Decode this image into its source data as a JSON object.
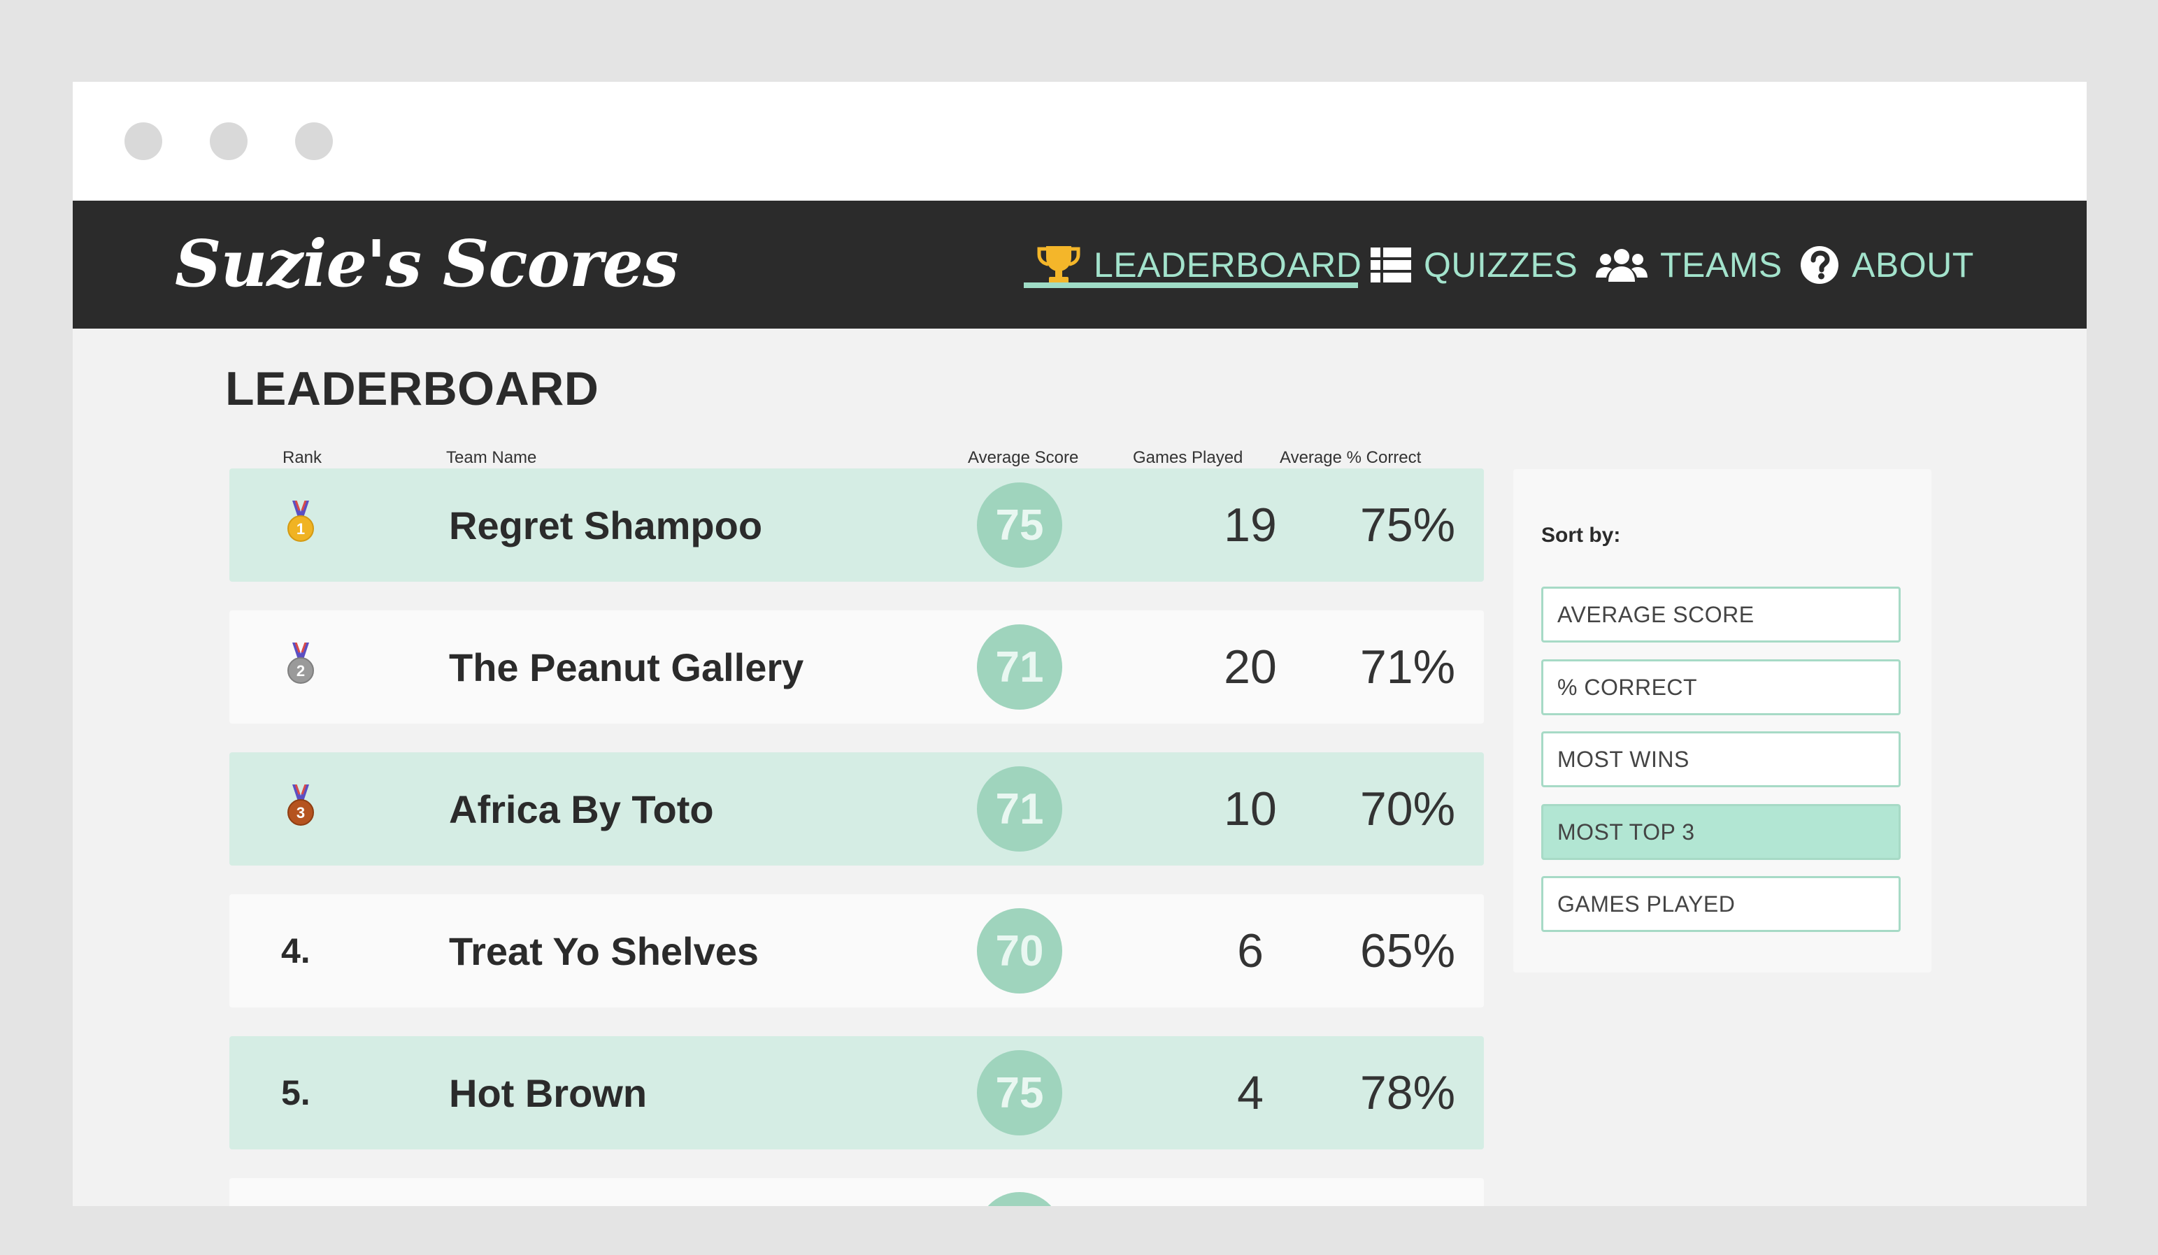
{
  "brand": "Suzie's Scores",
  "nav": [
    {
      "label": "LEADERBOARD",
      "icon": "trophy-icon"
    },
    {
      "label": "QUIZZES",
      "icon": "list-icon"
    },
    {
      "label": "TEAMS",
      "icon": "users-icon"
    },
    {
      "label": "ABOUT",
      "icon": "question-circle-icon"
    }
  ],
  "page_title": "LEADERBOARD",
  "columns": {
    "rank": "Rank",
    "team": "Team Name",
    "avg_score": "Average Score",
    "games": "Games Played",
    "avg_pct": "Average % Correct"
  },
  "rows": [
    {
      "rank": "1",
      "medal": "gold-medal-icon",
      "team": "Regret Shampoo",
      "score": "75",
      "games": "19",
      "pct": "75%"
    },
    {
      "rank": "2",
      "medal": "silver-medal-icon",
      "team": "The Peanut Gallery",
      "score": "71",
      "games": "20",
      "pct": "71%"
    },
    {
      "rank": "3",
      "medal": "bronze-medal-icon",
      "team": "Africa By Toto",
      "score": "71",
      "games": "10",
      "pct": "70%"
    },
    {
      "rank": "4.",
      "team": "Treat Yo Shelves",
      "score": "70",
      "games": "6",
      "pct": "65%"
    },
    {
      "rank": "5.",
      "team": "Hot Brown",
      "score": "75",
      "games": "4",
      "pct": "78%"
    }
  ],
  "sort": {
    "label": "Sort by:",
    "options": [
      "AVERAGE SCORE",
      "% CORRECT",
      "MOST WINS",
      "MOST TOP 3",
      "GAMES PLAYED"
    ],
    "selected": "MOST TOP 3"
  },
  "colors": {
    "accent": "#a3e3cc",
    "navbar": "#2b2b2b",
    "row_highlight": "#d5ede4",
    "score_circle": "#9fd4bd",
    "sort_active": "#b2e6d3"
  }
}
